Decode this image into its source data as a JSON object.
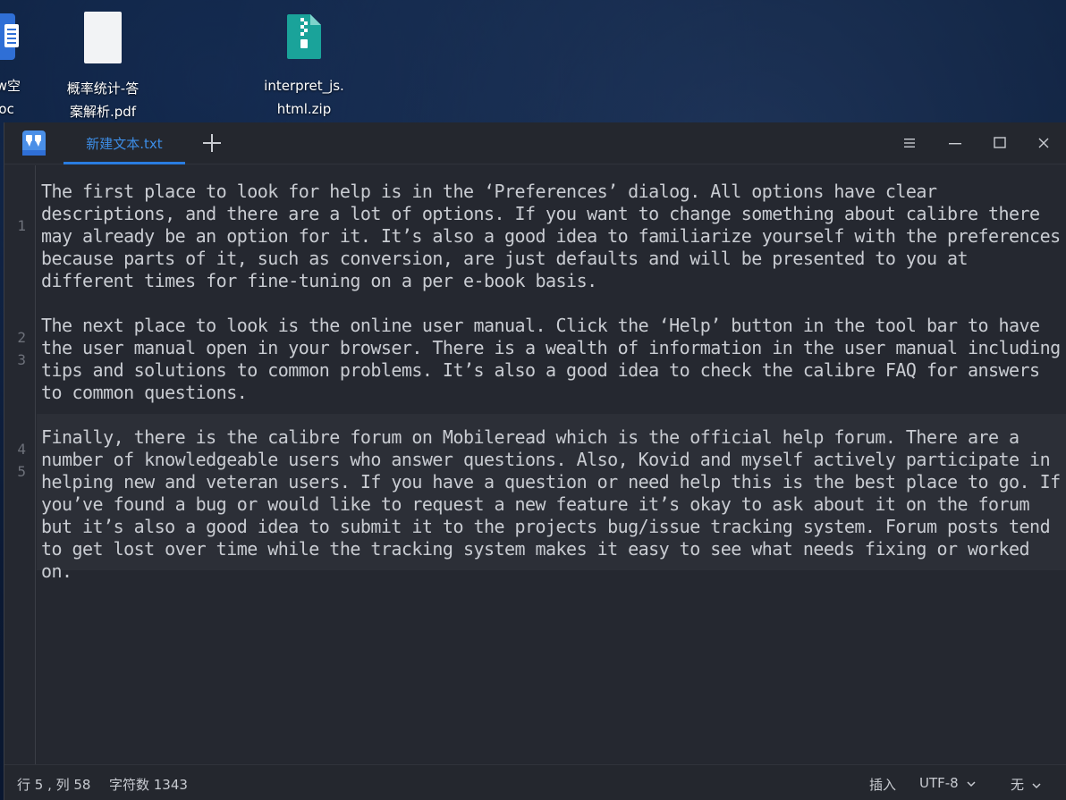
{
  "desktop": {
    "icons": [
      {
        "name": "word-doc",
        "caption_line1": "new空",
        "caption_line2": ".doc"
      },
      {
        "name": "pdf-file",
        "caption_line1": "概率统计-答",
        "caption_line2": "案解析.pdf"
      },
      {
        "name": "zip-file",
        "caption_line1": "interpret_js.",
        "caption_line2": "html.zip"
      }
    ]
  },
  "window": {
    "tab_label": "新建文本.txt",
    "accent_color": "#2a7de1"
  },
  "editor": {
    "line_numbers": [
      "1",
      "2",
      "3",
      "4",
      "5"
    ],
    "lines": [
      "The first place to look for help is in the ‘Preferences’ dialog. All options have clear descriptions, and there are a lot of options. If you want to change something about calibre there may already be an option for it. It’s also a good idea to familiarize yourself with the preferences because parts of it, such as conversion, are just defaults and will be presented to you at different times for fine-tuning on a per e-book basis.",
      "",
      "The next place to look is the online user manual. Click the ‘Help’ button in the tool bar to have the user manual open in your browser. There is a wealth of information in the user manual including tips and solutions to common problems. It’s also a good idea to check the calibre FAQ for answers to common questions.",
      "",
      "Finally, there is the calibre forum on Mobileread which is the official help forum. There are a number of knowledgeable users who answer questions. Also, Kovid and myself actively participate in helping new and veteran users. If you have a question or need help this is the best place to go. If you’ve found a bug or would like to request a new feature it’s okay to ask about it on the forum but it’s also a good idea to submit it to the projects bug/issue tracking system. Forum posts tend to get lost over time while the tracking system makes it easy to see what needs fixing or worked on."
    ]
  },
  "statusbar": {
    "position": "行 5 , 列 58",
    "char_count": "字符数 1343",
    "insert_mode": "插入",
    "encoding": "UTF-8",
    "highlight": "无"
  }
}
